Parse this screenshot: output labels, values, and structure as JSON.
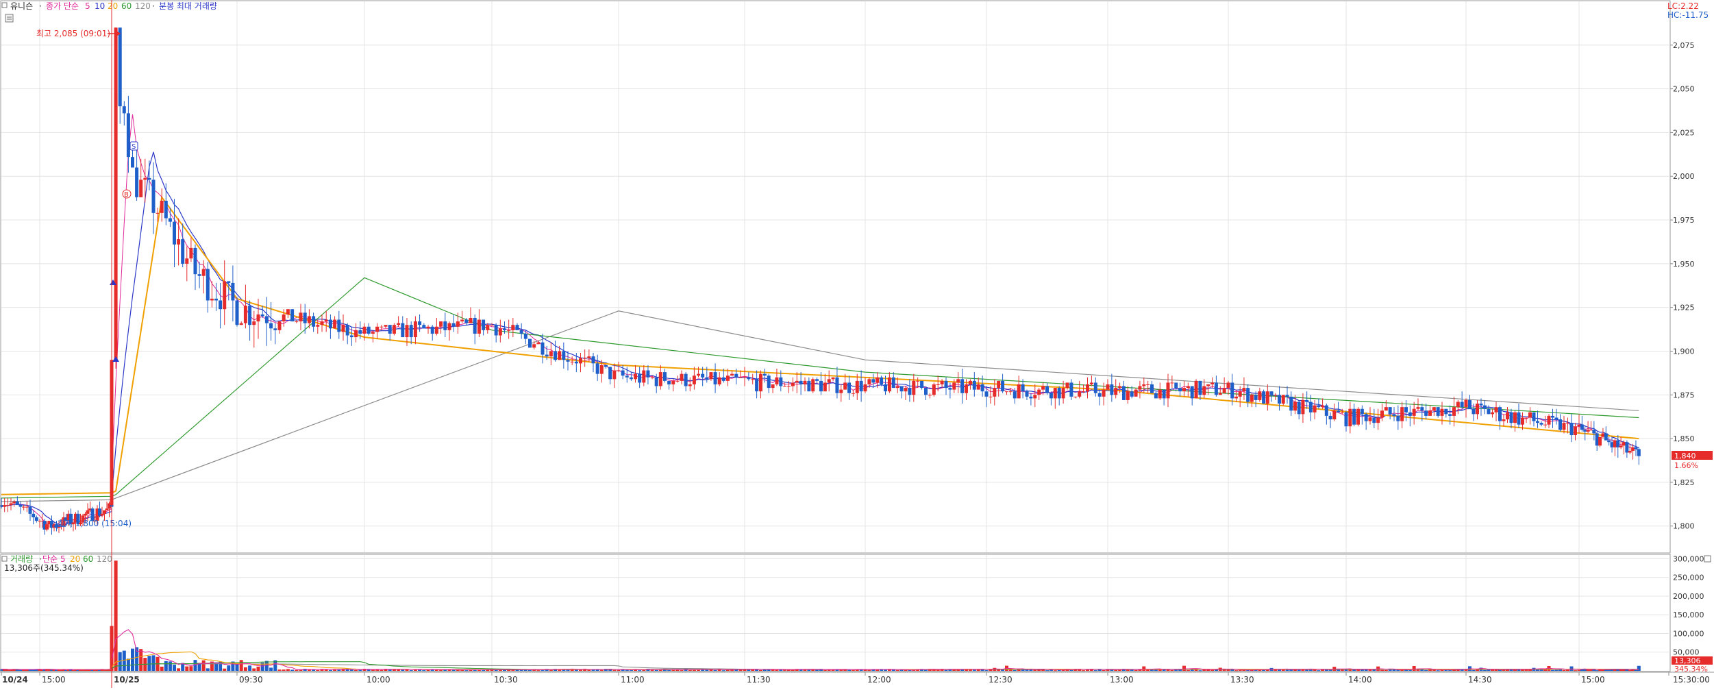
{
  "price_legend": {
    "name": "유니슨",
    "ma_prefix": "종가 단순",
    "periods": [
      "5",
      "10",
      "20",
      "60",
      "120"
    ],
    "extra": "분봉 최대 거래량"
  },
  "volume_legend": {
    "name": "거래량",
    "ma_prefix": "단순",
    "periods": [
      "5",
      "20",
      "60",
      "120"
    ],
    "current": "13,306주(345.34%)"
  },
  "annotations": {
    "high": "최고 2,085 (09:01)",
    "low": "최저 1,800 (15:04)",
    "lc": "LC:2.22",
    "hc": "HC:-11.75",
    "last_price": "1,840",
    "last_pct": "1.66%",
    "last_volume": "13,306",
    "last_volume_pct": "345.34%",
    "marker_s": "S",
    "marker_b": "B"
  },
  "colors": {
    "up": "#e62b2b",
    "down": "#1f5fc9",
    "ma5": "#e0289b",
    "ma10": "#2b37c8",
    "ma20": "#f0a000",
    "ma60": "#2e9a2e",
    "ma120": "#8c8c8c",
    "grid": "#e4e4e4"
  },
  "chart_data": [
    {
      "type": "candlestick",
      "title": "유니슨",
      "interval": "1-minute",
      "y_ticks": [
        1800,
        1825,
        1850,
        1875,
        1900,
        1925,
        1950,
        1975,
        2000,
        2025,
        2050,
        2075
      ],
      "y_tick_labels": [
        "1,800",
        "1,825",
        "1,850",
        "1,875",
        "1,900",
        "1,925",
        "1,950",
        "1,975",
        "2,000",
        "2,025",
        "2,050",
        "2,075"
      ],
      "ylim": [
        1785,
        2100
      ],
      "x_tick_labels": [
        "10/24",
        "15:00",
        "10/25",
        "09:30",
        "10:00",
        "10:30",
        "11:00",
        "11:30",
        "12:00",
        "12:30",
        "13:00",
        "13:30",
        "14:00",
        "14:30",
        "15:00",
        "15:30:00"
      ],
      "session_high": 2085,
      "session_high_time": "09:01",
      "session_low": 1800,
      "session_low_time": "15:04",
      "last_close": 1840,
      "price_path": [
        {
          "t": "10/24 14:48",
          "price": 1815
        },
        {
          "t": "10/24 15:04",
          "price": 1800
        },
        {
          "t": "10/24 15:30",
          "price": 1810
        },
        {
          "t": "10/25 09:01",
          "price": 2085
        },
        {
          "t": "10/25 09:05",
          "price": 2000
        },
        {
          "t": "10/25 09:10",
          "price": 1985
        },
        {
          "t": "10/25 09:20",
          "price": 1945
        },
        {
          "t": "10/25 09:30",
          "price": 1925
        },
        {
          "t": "10/25 10:00",
          "price": 1910
        },
        {
          "t": "10/25 10:30",
          "price": 1915
        },
        {
          "t": "10/25 11:00",
          "price": 1885
        },
        {
          "t": "10/25 12:00",
          "price": 1880
        },
        {
          "t": "10/25 13:00",
          "price": 1877
        },
        {
          "t": "10/25 13:30",
          "price": 1878
        },
        {
          "t": "10/25 14:00",
          "price": 1862
        },
        {
          "t": "10/25 14:30",
          "price": 1868
        },
        {
          "t": "10/25 15:00",
          "price": 1855
        },
        {
          "t": "10/25 15:20",
          "price": 1840
        }
      ],
      "moving_averages": {
        "ma20": [
          {
            "t": "10/25 09:01",
            "price": 1820
          },
          {
            "t": "10/25 09:12",
            "price": 1988
          },
          {
            "t": "10/25 09:30",
            "price": 1930
          },
          {
            "t": "10/25 10:00",
            "price": 1908
          },
          {
            "t": "10/25 11:00",
            "price": 1892
          },
          {
            "t": "10/25 13:00",
            "price": 1878
          },
          {
            "t": "10/25 15:20",
            "price": 1850
          }
        ],
        "ma60": [
          {
            "t": "10/25 09:01",
            "price": 1818
          },
          {
            "t": "10/25 10:00",
            "price": 1942
          },
          {
            "t": "10/25 10:30",
            "price": 1912
          },
          {
            "t": "10/25 12:00",
            "price": 1888
          },
          {
            "t": "10/25 15:20",
            "price": 1862
          }
        ],
        "ma120": [
          {
            "t": "10/25 09:01",
            "price": 1816
          },
          {
            "t": "10/25 11:00",
            "price": 1923
          },
          {
            "t": "10/25 12:00",
            "price": 1895
          },
          {
            "t": "10/25 15:20",
            "price": 1866
          }
        ]
      }
    },
    {
      "type": "bar",
      "title": "거래량",
      "y_ticks": [
        0,
        50000,
        100000,
        150000,
        200000,
        250000,
        300000
      ],
      "y_tick_labels": [
        "",
        "50,000",
        "100,000",
        "150,000",
        "200,000",
        "250,000",
        "300,000"
      ],
      "ylim": [
        0,
        310000
      ],
      "peak_volume": 295000,
      "peak_time": "10/25 09:01",
      "last_volume": 13306
    }
  ]
}
